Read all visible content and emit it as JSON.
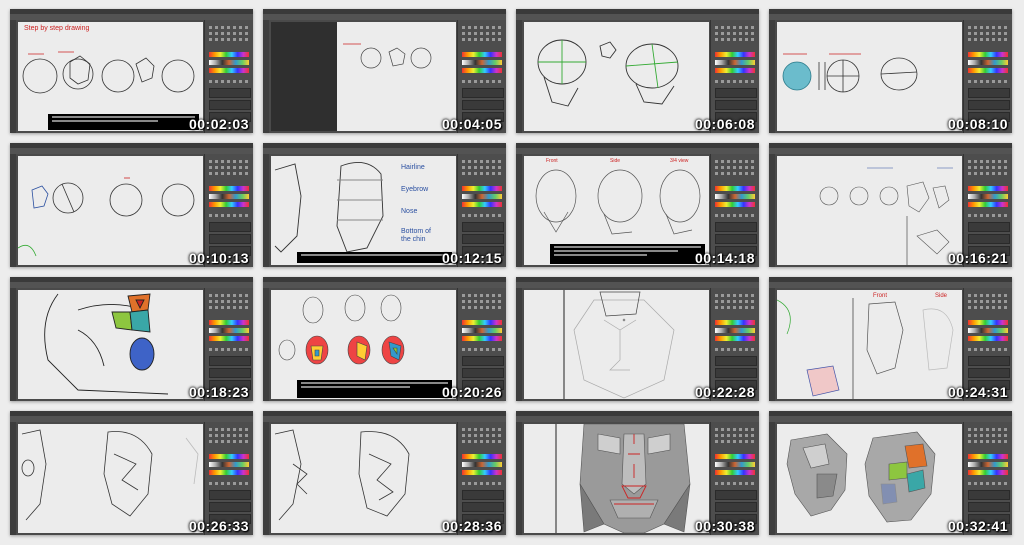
{
  "thumbnails": [
    {
      "timestamp": "00:02:03",
      "title": "Step by step drawing"
    },
    {
      "timestamp": "00:04:05"
    },
    {
      "timestamp": "00:06:08"
    },
    {
      "timestamp": "00:08:10"
    },
    {
      "timestamp": "00:10:13"
    },
    {
      "timestamp": "00:12:15",
      "labels": [
        "Hairline",
        "Eyebrow",
        "Nose",
        "Bottom of",
        "the chin"
      ]
    },
    {
      "timestamp": "00:14:18",
      "labels": [
        "Front",
        "Side",
        "3/4 view"
      ]
    },
    {
      "timestamp": "00:16:21"
    },
    {
      "timestamp": "00:18:23"
    },
    {
      "timestamp": "00:20:26"
    },
    {
      "timestamp": "00:22:28"
    },
    {
      "timestamp": "00:24:31",
      "labels": [
        "Front",
        "Side"
      ]
    },
    {
      "timestamp": "00:26:33"
    },
    {
      "timestamp": "00:28:36"
    },
    {
      "timestamp": "00:30:38"
    },
    {
      "timestamp": "00:32:41"
    }
  ],
  "colors": {
    "accent_red": "#cc2222",
    "accent_blue": "#2a4fa0",
    "ui_dark": "#4a4a4a",
    "canvas": "#ececec"
  }
}
